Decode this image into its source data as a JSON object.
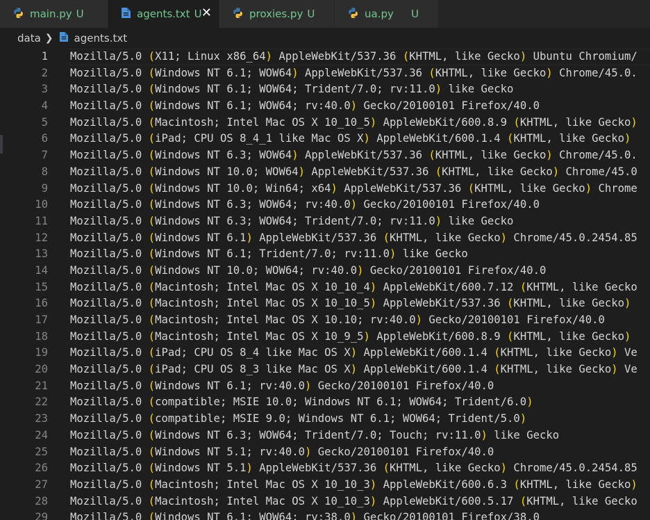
{
  "tabs": [
    {
      "label": "main.py",
      "status": "U",
      "icon": "python-icon",
      "active": false
    },
    {
      "label": "agents.txt",
      "status": "U",
      "icon": "file-icon",
      "active": true
    },
    {
      "label": "proxies.py",
      "status": "U",
      "icon": "python-icon",
      "active": false
    },
    {
      "label": "ua.py",
      "status": "U",
      "icon": "python-icon",
      "active": false
    }
  ],
  "breadcrumb": {
    "folder": "data",
    "file": "agents.txt"
  },
  "colors": {
    "bracket": "#ffd700",
    "text": "#d4d4d4",
    "untracked": "#73c991",
    "lineNumber": "#858585"
  },
  "lines": [
    {
      "n": "1",
      "pre": "Mozilla/5.0 ",
      "inner": "X11; Linux x86_64",
      "post": " AppleWebKit/537.36 ",
      "inner2": "KHTML, like Gecko",
      "post2": " Ubuntu Chromium/",
      "open2": true
    },
    {
      "n": "2",
      "pre": "Mozilla/5.0 ",
      "inner": "Windows NT 6.1; WOW64",
      "post": " AppleWebKit/537.36 ",
      "inner2": "KHTML, like Gecko",
      "post2": " Chrome/45.0."
    },
    {
      "n": "3",
      "pre": "Mozilla/5.0 ",
      "inner": "Windows NT 6.1; WOW64; Trident/7.0; rv:11.0",
      "post": " like Gecko"
    },
    {
      "n": "4",
      "pre": "Mozilla/5.0 ",
      "inner": "Windows NT 6.1; WOW64; rv:40.0",
      "post": " Gecko/20100101 Firefox/40.0"
    },
    {
      "n": "5",
      "pre": "Mozilla/5.0 ",
      "inner": "Macintosh; Intel Mac OS X 10_10_5",
      "post": " AppleWebKit/600.8.9 ",
      "inner2": "KHTML, like Gecko",
      "post2": ""
    },
    {
      "n": "6",
      "pre": "Mozilla/5.0 ",
      "inner": "iPad; CPU OS 8_4_1 like Mac OS X",
      "post": " AppleWebKit/600.1.4 ",
      "inner2": "KHTML, like Gecko",
      "post2": ""
    },
    {
      "n": "7",
      "pre": "Mozilla/5.0 ",
      "inner": "Windows NT 6.3; WOW64",
      "post": " AppleWebKit/537.36 ",
      "inner2": "KHTML, like Gecko",
      "post2": " Chrome/45.0."
    },
    {
      "n": "8",
      "pre": "Mozilla/5.0 ",
      "inner": "Windows NT 10.0; WOW64",
      "post": " AppleWebKit/537.36 ",
      "inner2": "KHTML, like Gecko",
      "post2": " Chrome/45.0"
    },
    {
      "n": "9",
      "pre": "Mozilla/5.0 ",
      "inner": "Windows NT 10.0; Win64; x64",
      "post": " AppleWebKit/537.36 ",
      "inner2": "KHTML, like Gecko",
      "post2": " Chrome"
    },
    {
      "n": "10",
      "pre": "Mozilla/5.0 ",
      "inner": "Windows NT 6.3; WOW64; rv:40.0",
      "post": " Gecko/20100101 Firefox/40.0"
    },
    {
      "n": "11",
      "pre": "Mozilla/5.0 ",
      "inner": "Windows NT 6.3; WOW64; Trident/7.0; rv:11.0",
      "post": " like Gecko"
    },
    {
      "n": "12",
      "pre": "Mozilla/5.0 ",
      "inner": "Windows NT 6.1",
      "post": " AppleWebKit/537.36 ",
      "inner2": "KHTML, like Gecko",
      "post2": " Chrome/45.0.2454.85"
    },
    {
      "n": "13",
      "pre": "Mozilla/5.0 ",
      "inner": "Windows NT 6.1; Trident/7.0; rv:11.0",
      "post": " like Gecko"
    },
    {
      "n": "14",
      "pre": "Mozilla/5.0 ",
      "inner": "Windows NT 10.0; WOW64; rv:40.0",
      "post": " Gecko/20100101 Firefox/40.0"
    },
    {
      "n": "15",
      "pre": "Mozilla/5.0 ",
      "inner": "Macintosh; Intel Mac OS X 10_10_4",
      "post": " AppleWebKit/600.7.12 ",
      "inner2": "KHTML, like Gecko",
      "post2": "",
      "cut2": true
    },
    {
      "n": "16",
      "pre": "Mozilla/5.0 ",
      "inner": "Macintosh; Intel Mac OS X 10_10_5",
      "post": " AppleWebKit/537.36 ",
      "inner2": "KHTML, like Gecko",
      "post2": ""
    },
    {
      "n": "17",
      "pre": "Mozilla/5.0 ",
      "inner": "Macintosh; Intel Mac OS X 10.10; rv:40.0",
      "post": " Gecko/20100101 Firefox/40.0"
    },
    {
      "n": "18",
      "pre": "Mozilla/5.0 ",
      "inner": "Macintosh; Intel Mac OS X 10_9_5",
      "post": " AppleWebKit/600.8.9 ",
      "inner2": "KHTML, like Gecko",
      "post2": ""
    },
    {
      "n": "19",
      "pre": "Mozilla/5.0 ",
      "inner": "iPad; CPU OS 8_4 like Mac OS X",
      "post": " AppleWebKit/600.1.4 ",
      "inner2": "KHTML, like Gecko",
      "post2": " Ve"
    },
    {
      "n": "20",
      "pre": "Mozilla/5.0 ",
      "inner": "iPad; CPU OS 8_3 like Mac OS X",
      "post": " AppleWebKit/600.1.4 ",
      "inner2": "KHTML, like Gecko",
      "post2": " Ve"
    },
    {
      "n": "21",
      "pre": "Mozilla/5.0 ",
      "inner": "Windows NT 6.1; rv:40.0",
      "post": " Gecko/20100101 Firefox/40.0"
    },
    {
      "n": "22",
      "pre": "Mozilla/5.0 ",
      "inner": "compatible; MSIE 10.0; Windows NT 6.1; WOW64; Trident/6.0",
      "post": ""
    },
    {
      "n": "23",
      "pre": "Mozilla/5.0 ",
      "inner": "compatible; MSIE 9.0; Windows NT 6.1; WOW64; Trident/5.0",
      "post": ""
    },
    {
      "n": "24",
      "pre": "Mozilla/5.0 ",
      "inner": "Windows NT 6.3; WOW64; Trident/7.0; Touch; rv:11.0",
      "post": " like Gecko"
    },
    {
      "n": "25",
      "pre": "Mozilla/5.0 ",
      "inner": "Windows NT 5.1; rv:40.0",
      "post": " Gecko/20100101 Firefox/40.0"
    },
    {
      "n": "26",
      "pre": "Mozilla/5.0 ",
      "inner": "Windows NT 5.1",
      "post": " AppleWebKit/537.36 ",
      "inner2": "KHTML, like Gecko",
      "post2": " Chrome/45.0.2454.85"
    },
    {
      "n": "27",
      "pre": "Mozilla/5.0 ",
      "inner": "Macintosh; Intel Mac OS X 10_10_3",
      "post": " AppleWebKit/600.6.3 ",
      "inner2": "KHTML, like Gecko",
      "post2": ""
    },
    {
      "n": "28",
      "pre": "Mozilla/5.0 ",
      "inner": "Macintosh; Intel Mac OS X 10_10_3",
      "post": " AppleWebKit/600.5.17 ",
      "inner2": "KHTML, like Gecko",
      "post2": "",
      "cut2": true
    },
    {
      "n": "29",
      "pre": "Mozilla/5.0 ",
      "inner": "Windows NT 6.1; WOW64; rv:38.0",
      "post": " Gecko/20100101 Firefox/38.0"
    }
  ]
}
